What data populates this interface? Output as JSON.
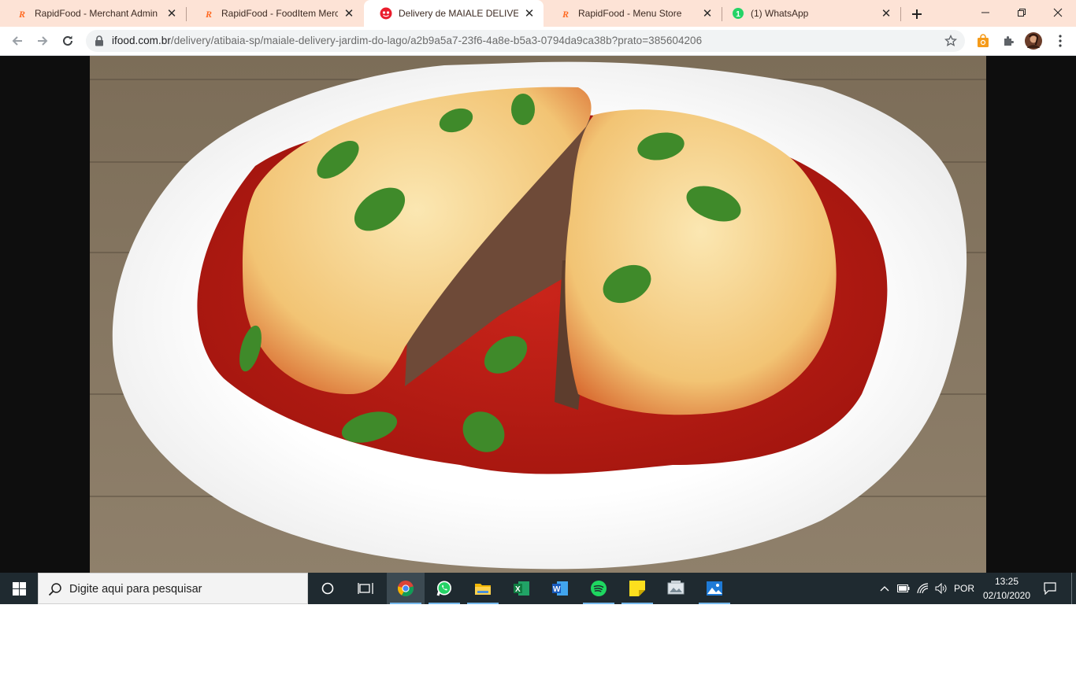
{
  "browser": {
    "tabs": [
      {
        "label": "RapidFood - Merchant Admin",
        "icon": "rapidfood-icon",
        "active": false
      },
      {
        "label": "RapidFood - FoodItem Mercha",
        "icon": "rapidfood-icon",
        "active": false
      },
      {
        "label": "Delivery de MAIALE DELIVERY",
        "icon": "ifood-icon",
        "active": true
      },
      {
        "label": "RapidFood - Menu Store",
        "icon": "rapidfood-icon",
        "active": false
      },
      {
        "label": "(1) WhatsApp",
        "icon": "whatsapp-badge-icon",
        "active": false
      }
    ],
    "url_host": "ifood.com.br",
    "url_path": "/delivery/atibaia-sp/maiale-delivery-jardim-do-lago/a2b9a5a7-23f6-4a8e-b5a3-0794da9ca38b?prato=385604206",
    "whatsapp_badge": "1"
  },
  "page": {
    "image_subject": "dish-photo"
  },
  "taskbar": {
    "search_placeholder": "Digite aqui para pesquisar",
    "pinned": [
      "cortana",
      "task-view",
      "chrome",
      "whatsapp",
      "file-explorer",
      "excel",
      "word",
      "spotify",
      "sticky-notes",
      "photo-viewer",
      "photos"
    ],
    "language": "POR",
    "time": "13:25",
    "date": "02/10/2020"
  },
  "colors": {
    "tabstrip": "#fde3d6",
    "taskbar": "#1f2a30",
    "ifood_red": "#ea1d2c",
    "whatsapp_green": "#25d366"
  }
}
